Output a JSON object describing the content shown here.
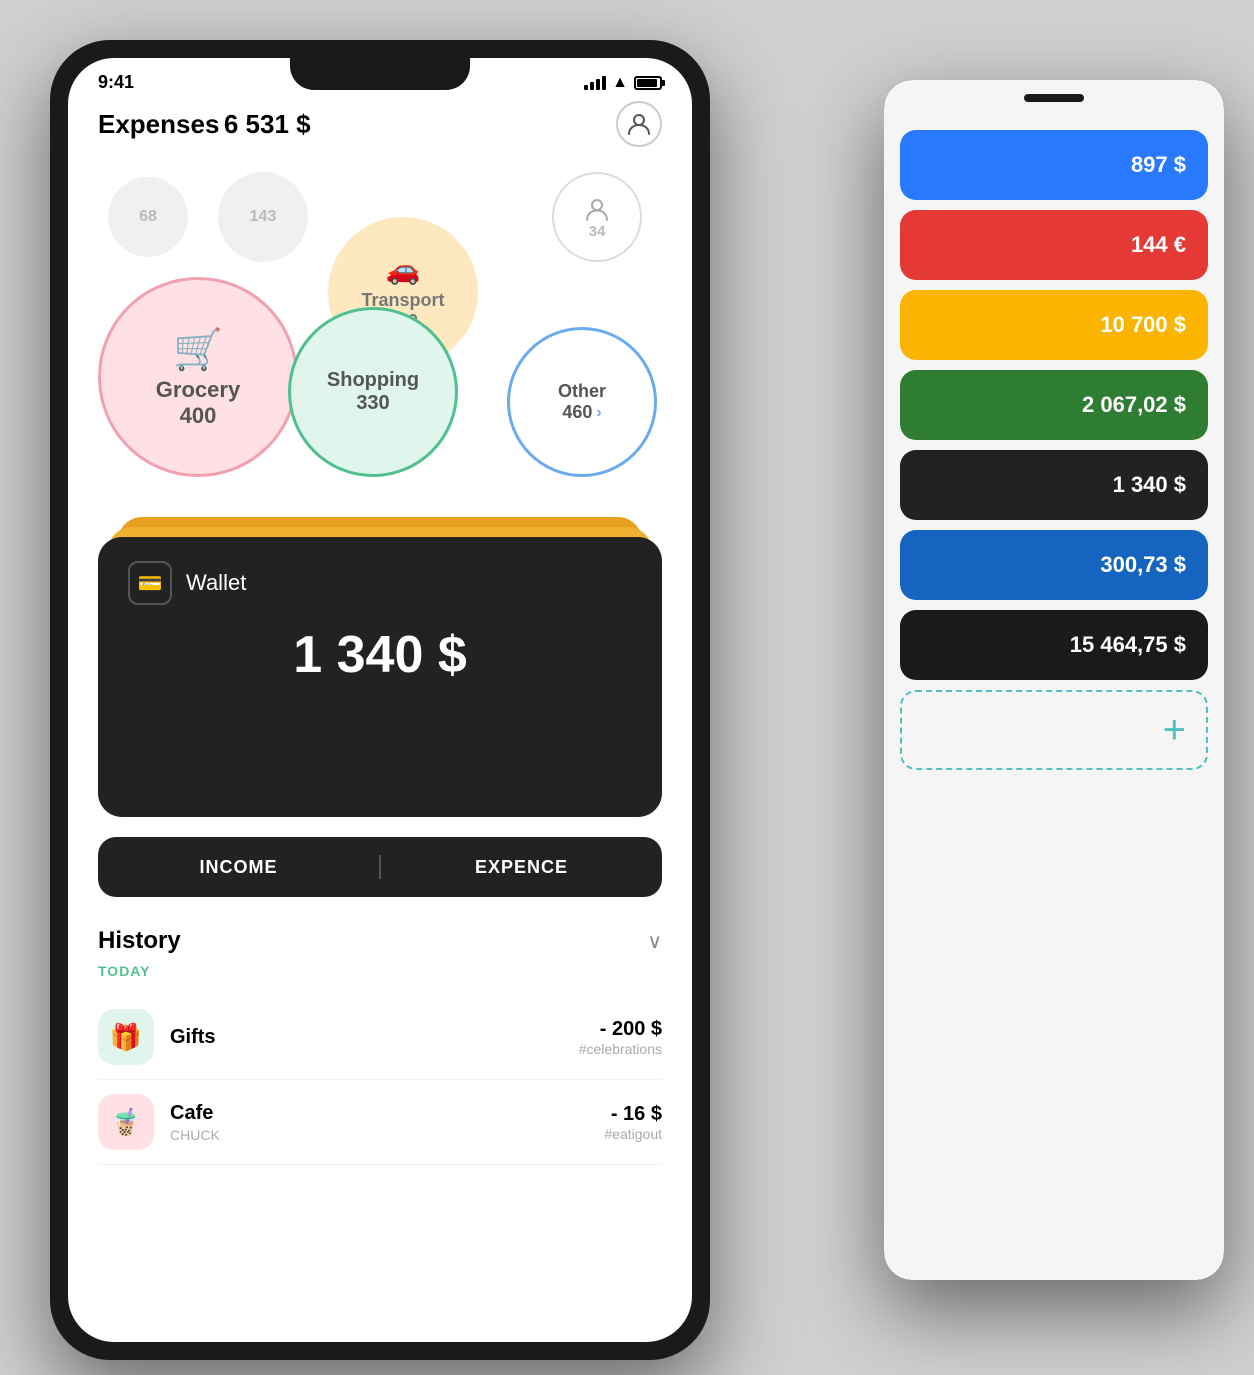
{
  "scene": {
    "background": "#d0d0d0"
  },
  "iphone": {
    "status_bar": {
      "time": "9:41",
      "signal": "●●●●",
      "wifi": "WiFi",
      "battery": "100%"
    },
    "expenses": {
      "title": "Expenses",
      "amount": "6 531 $"
    },
    "bubbles": [
      {
        "id": "small1",
        "value": "68",
        "label": ""
      },
      {
        "id": "small2",
        "value": "143",
        "label": ""
      },
      {
        "id": "profile",
        "value": "34",
        "label": ""
      },
      {
        "id": "transport",
        "label": "Transport",
        "value": "380"
      },
      {
        "id": "grocery",
        "label": "Grocery",
        "value": "400"
      },
      {
        "id": "shopping",
        "label": "Shopping",
        "value": "330"
      },
      {
        "id": "other",
        "label": "Other",
        "value": "460"
      }
    ],
    "wallet": {
      "icon": "💳",
      "name": "Wallet",
      "amount": "1 340 $"
    },
    "tabs": {
      "income": "INCOME",
      "expense": "EXPENCE"
    },
    "history": {
      "title": "History",
      "date_label": "TODAY",
      "items": [
        {
          "name": "Gifts",
          "icon": "🎁",
          "amount": "- 200 $",
          "tag": "#celebrations"
        },
        {
          "name": "Cafe",
          "sub": "CHUCK",
          "icon": "🧋",
          "amount": "- 16 $",
          "tag": "#eatigout"
        }
      ]
    }
  },
  "android": {
    "cards": [
      {
        "id": "card1",
        "amount": "897 $",
        "color": "blue",
        "dark_text": false
      },
      {
        "id": "card2",
        "amount": "144 €",
        "color": "red",
        "dark_text": false
      },
      {
        "id": "card3",
        "amount": "10 700 $",
        "color": "yellow",
        "dark_text": false
      },
      {
        "id": "card4",
        "amount": "2 067,02 $",
        "color": "green",
        "dark_text": false
      },
      {
        "id": "card5",
        "amount": "1 340 $",
        "color": "dark",
        "dark_text": false
      },
      {
        "id": "card6",
        "amount": "300,73 $",
        "color": "blue2",
        "dark_text": false
      },
      {
        "id": "card7",
        "amount": "15 464,75 $",
        "color": "dark2",
        "dark_text": false
      }
    ],
    "add_button": "+"
  }
}
